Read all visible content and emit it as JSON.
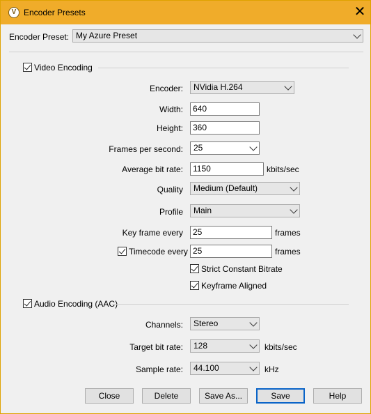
{
  "window": {
    "title": "Encoder Presets",
    "icon": "app-logo-icon",
    "close_glyph": "✕"
  },
  "preset": {
    "label": "Encoder Preset:",
    "value": "My Azure Preset"
  },
  "video": {
    "section_label": "Video Encoding",
    "enabled": true,
    "encoder": {
      "label": "Encoder:",
      "value": "NVidia H.264"
    },
    "width": {
      "label": "Width:",
      "value": "640"
    },
    "height": {
      "label": "Height:",
      "value": "360"
    },
    "fps": {
      "label": "Frames per second:",
      "value": "25"
    },
    "bitrate": {
      "label": "Average bit rate:",
      "value": "1150",
      "unit": "kbits/sec"
    },
    "quality": {
      "label": "Quality",
      "value": "Medium (Default)"
    },
    "profile": {
      "label": "Profile",
      "value": "Main"
    },
    "keyframe": {
      "label": "Key frame every",
      "value": "25",
      "unit": "frames"
    },
    "timecode": {
      "label": "Timecode every",
      "value": "25",
      "unit": "frames",
      "checked": true
    },
    "strict_cbr": {
      "label": "Strict Constant Bitrate",
      "checked": true
    },
    "keyframe_aligned": {
      "label": "Keyframe Aligned",
      "checked": true
    }
  },
  "audio": {
    "section_label": "Audio Encoding (AAC)",
    "enabled": true,
    "channels": {
      "label": "Channels:",
      "value": "Stereo"
    },
    "bitrate": {
      "label": "Target bit rate:",
      "value": "128",
      "unit": "kbits/sec"
    },
    "sample_rate": {
      "label": "Sample rate:",
      "value": "44.100",
      "unit": "kHz"
    }
  },
  "buttons": {
    "close": "Close",
    "delete": "Delete",
    "save_as": "Save As...",
    "save": "Save",
    "help": "Help"
  },
  "colors": {
    "titlebar": "#f0ac2a",
    "dialog_bg": "#f0f0f0",
    "default_button_border": "#0a64c8"
  }
}
